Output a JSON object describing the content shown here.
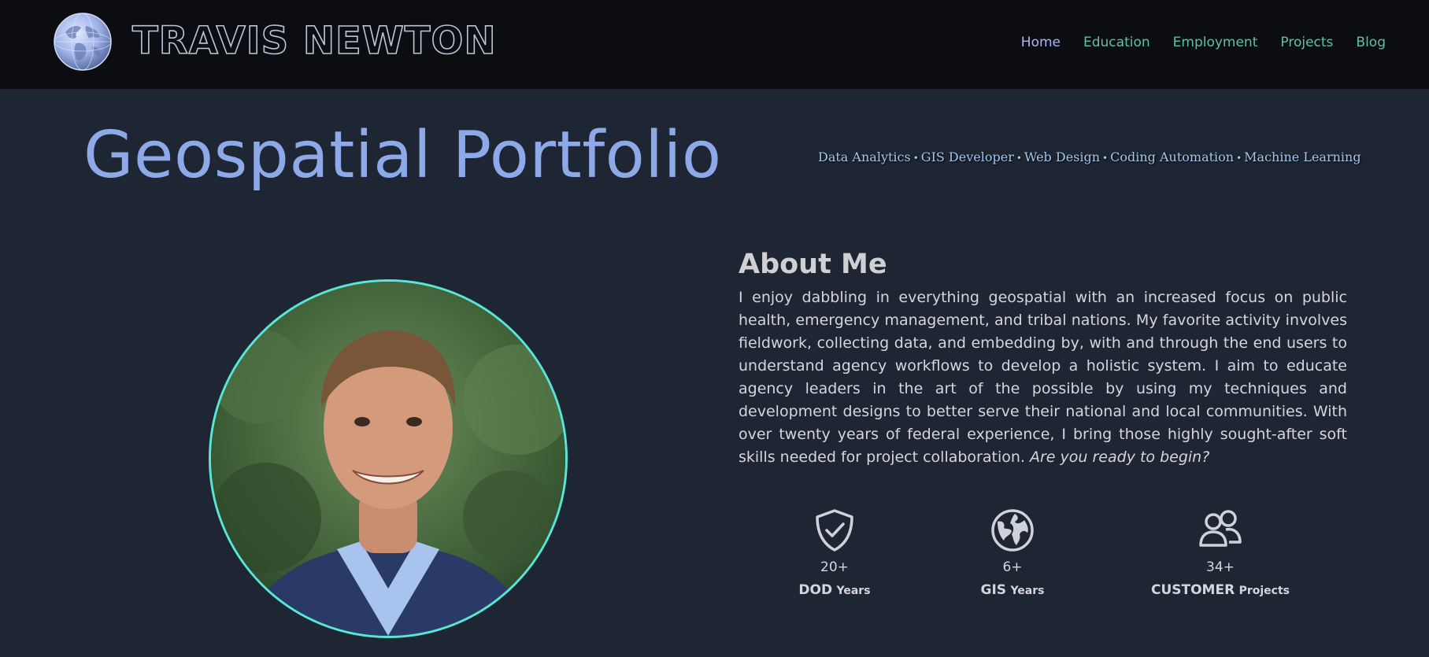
{
  "header": {
    "brand": "TRAVIS NEWTON",
    "nav": [
      {
        "label": "Home",
        "active": true
      },
      {
        "label": "Education",
        "active": false
      },
      {
        "label": "Employment",
        "active": false
      },
      {
        "label": "Projects",
        "active": false
      },
      {
        "label": "Blog",
        "active": false
      }
    ]
  },
  "hero": {
    "title": "Geospatial Portfolio",
    "tags": [
      "Data Analytics",
      "GIS Developer",
      "Web Design",
      "Coding Automation",
      "Machine Learning"
    ]
  },
  "about": {
    "heading": "About Me",
    "body": "I enjoy dabbling in everything geospatial with an increased focus on public health, emergency management, and tribal nations. My favorite activity involves fieldwork, collecting data, and embedding by, with and through the end users to understand agency workflows to develop a holistic system. I aim to educate agency leaders in the art of the possible by using my techniques and development designs to better serve their national and local communities. With over twenty years of federal experience, I bring those highly sought-after soft skills needed for project collaboration.",
    "cta": "Are you ready to begin?"
  },
  "stats": [
    {
      "icon": "shield-check-icon",
      "value": "20+",
      "label_bold": "DOD",
      "label_small": "Years"
    },
    {
      "icon": "globe-icon",
      "value": "6+",
      "label_bold": "GIS",
      "label_small": "Years"
    },
    {
      "icon": "users-icon",
      "value": "34+",
      "label_bold": "CUSTOMER",
      "label_small": "Projects"
    }
  ],
  "colors": {
    "background": "#1f2633",
    "header_bg": "#0b0d11",
    "nav_link": "#5fbfa9",
    "nav_active": "#a9b8f5",
    "title": "#8ea9e8",
    "photo_ring": "#58e6d6"
  }
}
